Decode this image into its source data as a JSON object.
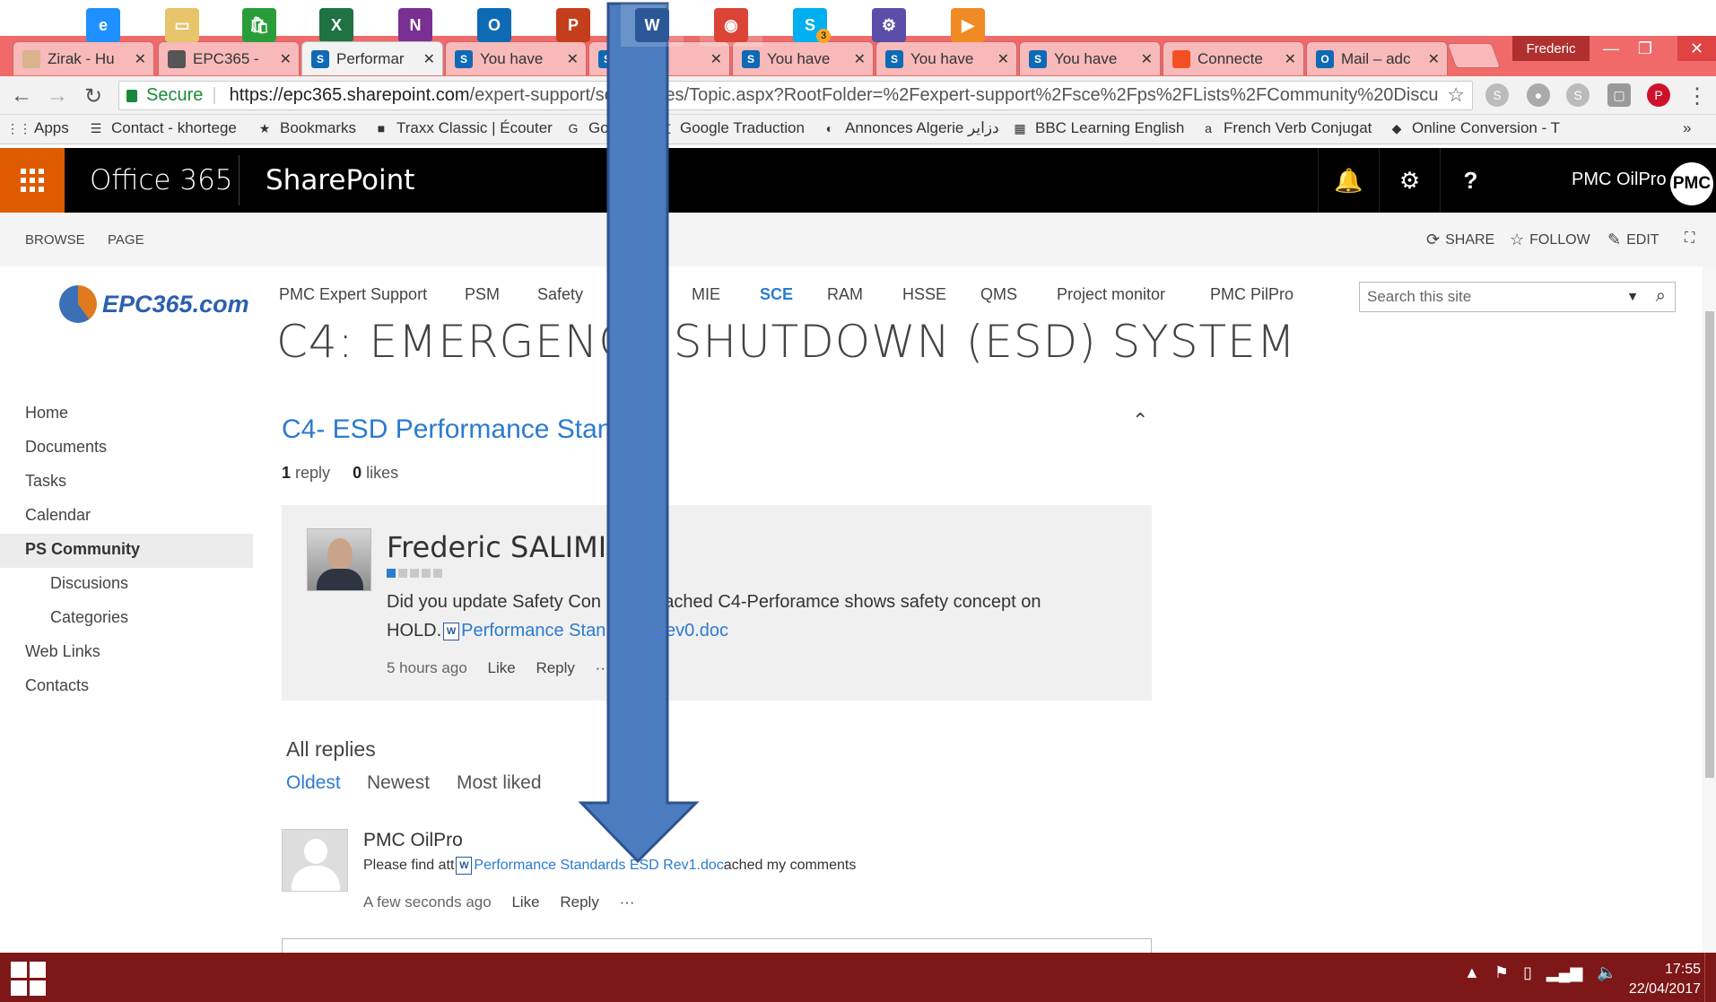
{
  "browser": {
    "tabs": [
      {
        "title": "Zirak - Hu",
        "icon": "image-icon",
        "icon_color": "#d9b38c"
      },
      {
        "title": "EPC365 - ",
        "icon": "photo-icon",
        "icon_color": "#555555"
      },
      {
        "title": "Performar",
        "icon": "sharepoint-icon",
        "icon_color": "#0f6ab4",
        "active": true
      },
      {
        "title": "You have",
        "icon": "sharepoint-icon",
        "icon_color": "#0f6ab4"
      },
      {
        "title": "ave",
        "icon": "sharepoint-icon",
        "icon_color": "#0f6ab4"
      },
      {
        "title": "You have",
        "icon": "sharepoint-icon",
        "icon_color": "#0f6ab4"
      },
      {
        "title": "You have",
        "icon": "sharepoint-icon",
        "icon_color": "#0f6ab4"
      },
      {
        "title": "You have",
        "icon": "sharepoint-icon",
        "icon_color": "#0f6ab4"
      },
      {
        "title": "Connecte",
        "icon": "microsoft-icon",
        "icon_color": "#f25022"
      },
      {
        "title": "Mail – adc",
        "icon": "outlook-icon",
        "icon_color": "#0f6ab4"
      }
    ],
    "tab_close": "✕",
    "profile": "Frederic",
    "address": {
      "secure_label": "Secure",
      "url_host": "https://epc365.sharepoint.com",
      "url_path": "/expert-support/sc      tePages/Topic.aspx?RootFolder=%2Fexpert-support%2Fsce%2Fps%2FLists%2FCommunity%20Discu"
    },
    "bookmarks": [
      {
        "label": "Apps",
        "icon": "apps-grid-icon"
      },
      {
        "label": "Contact - khortege",
        "icon": "contact-icon"
      },
      {
        "label": "Bookmarks",
        "icon": "star-icon"
      },
      {
        "label": "Traxx Classic | Écouter",
        "icon": "traxx-icon"
      },
      {
        "label": "Go",
        "icon": "google-icon"
      },
      {
        "label": "Google Traduction",
        "icon": "translate-icon"
      },
      {
        "label": "Annonces Algerie دزاير",
        "icon": "annonces-icon"
      },
      {
        "label": "BBC Learning English",
        "icon": "bbc-icon"
      },
      {
        "label": "French Verb Conjugat",
        "icon": "conjugation-icon"
      },
      {
        "label": "Online Conversion - T",
        "icon": "conversion-icon"
      }
    ],
    "bookmarks_more": "»"
  },
  "suite": {
    "office_label": "Office 365",
    "app_label": "SharePoint",
    "user_name": "PMC OilPro",
    "avatar_initials": "PMC",
    "accent": "#e05a00"
  },
  "ribbon": {
    "tabs": [
      "BROWSE",
      "PAGE"
    ],
    "share": "SHARE",
    "follow": "FOLLOW",
    "edit": "EDIT"
  },
  "site": {
    "logo_text": "EPC365.com",
    "top_nav": [
      "PMC Expert Support",
      "PSM",
      "Safety",
      "MIE",
      "SCE",
      "RAM",
      "HSSE",
      "QMS",
      "Project monitor",
      "PMC PilPro"
    ],
    "top_nav_selected": "SCE",
    "search_placeholder": "Search this site",
    "page_title": "C4: EMERGENCY SHUTDOWN (ESD) SYSTEM"
  },
  "left_nav": [
    {
      "label": "Home"
    },
    {
      "label": "Documents"
    },
    {
      "label": "Tasks"
    },
    {
      "label": "Calendar"
    },
    {
      "label": "PS Community",
      "selected": true
    },
    {
      "label": "Discusions",
      "sub": true
    },
    {
      "label": "Categories",
      "sub": true
    },
    {
      "label": "Web Links"
    },
    {
      "label": "Contacts"
    }
  ],
  "discussion": {
    "title": "C4- ESD Performance Stand",
    "replies_count": "1",
    "replies_label": "reply",
    "likes_count": "0",
    "likes_label": "likes",
    "post": {
      "author": "Frederic SALIMI",
      "rating_level": 1,
      "rating_max": 5,
      "text_before": "Did you update Safety Con",
      "text_mid": "attached C4-Perforamce shows safety concept on",
      "text_line2": "HOLD.",
      "attachment": "Performance Stan        ESD Rev0.doc",
      "time": "5 hours ago",
      "like": "Like",
      "reply": "Reply",
      "more": "···"
    },
    "all_replies_label": "All replies",
    "sort_options": [
      "Oldest",
      "Newest",
      "Most liked"
    ],
    "sort_selected": "Oldest",
    "reply": {
      "author": "PMC OilPro",
      "text_before": "Please find att",
      "attachment": "Performance Standards ESD Rev1.doc",
      "text_after": "ached my comments",
      "time": "A few seconds ago",
      "like": "Like",
      "reply": "Reply",
      "more": "···"
    }
  },
  "taskbar": {
    "apps": [
      "internet-explorer-icon",
      "file-explorer-icon",
      "store-icon",
      "excel-icon",
      "onenote-icon",
      "outlook-icon",
      "powerpoint-icon",
      "word-icon",
      "chrome-icon",
      "skype-icon",
      "settings-icon",
      "media-player-icon"
    ],
    "skype_badge": "3",
    "time": "17:55",
    "date": "22/04/2017"
  }
}
